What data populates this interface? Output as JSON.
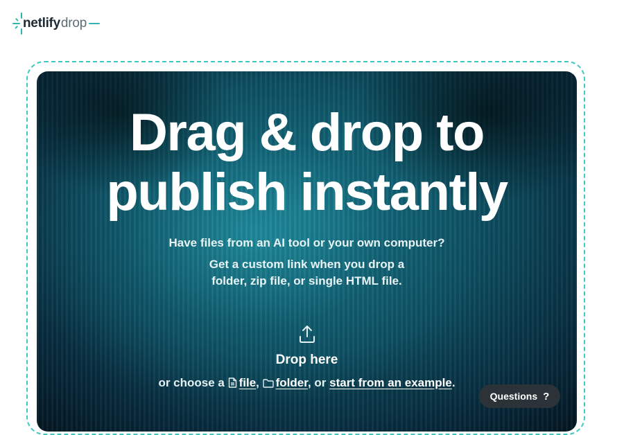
{
  "header": {
    "logo_primary": "netlify",
    "logo_secondary": "drop",
    "brand_color": "#32b4ad"
  },
  "drop_zone": {
    "headline_line1": "Drag & drop to",
    "headline_line2": "publish instantly",
    "subtitle_line1": "Have files from an AI tool or your own computer?",
    "subtitle_line2": "Get a custom link when you drop a",
    "subtitle_line3": "folder, zip file, or single HTML file.",
    "upload_icon": "upload-icon",
    "drop_label": "Drop here",
    "choose_prefix": "or choose a",
    "file_link": "file",
    "separator1": ",",
    "folder_link": "folder",
    "separator2": ", or",
    "example_link": "start from an example",
    "choose_suffix": ".",
    "border_color": "#3cc9c1"
  },
  "help": {
    "questions_label": "Questions",
    "questions_icon": "?"
  }
}
